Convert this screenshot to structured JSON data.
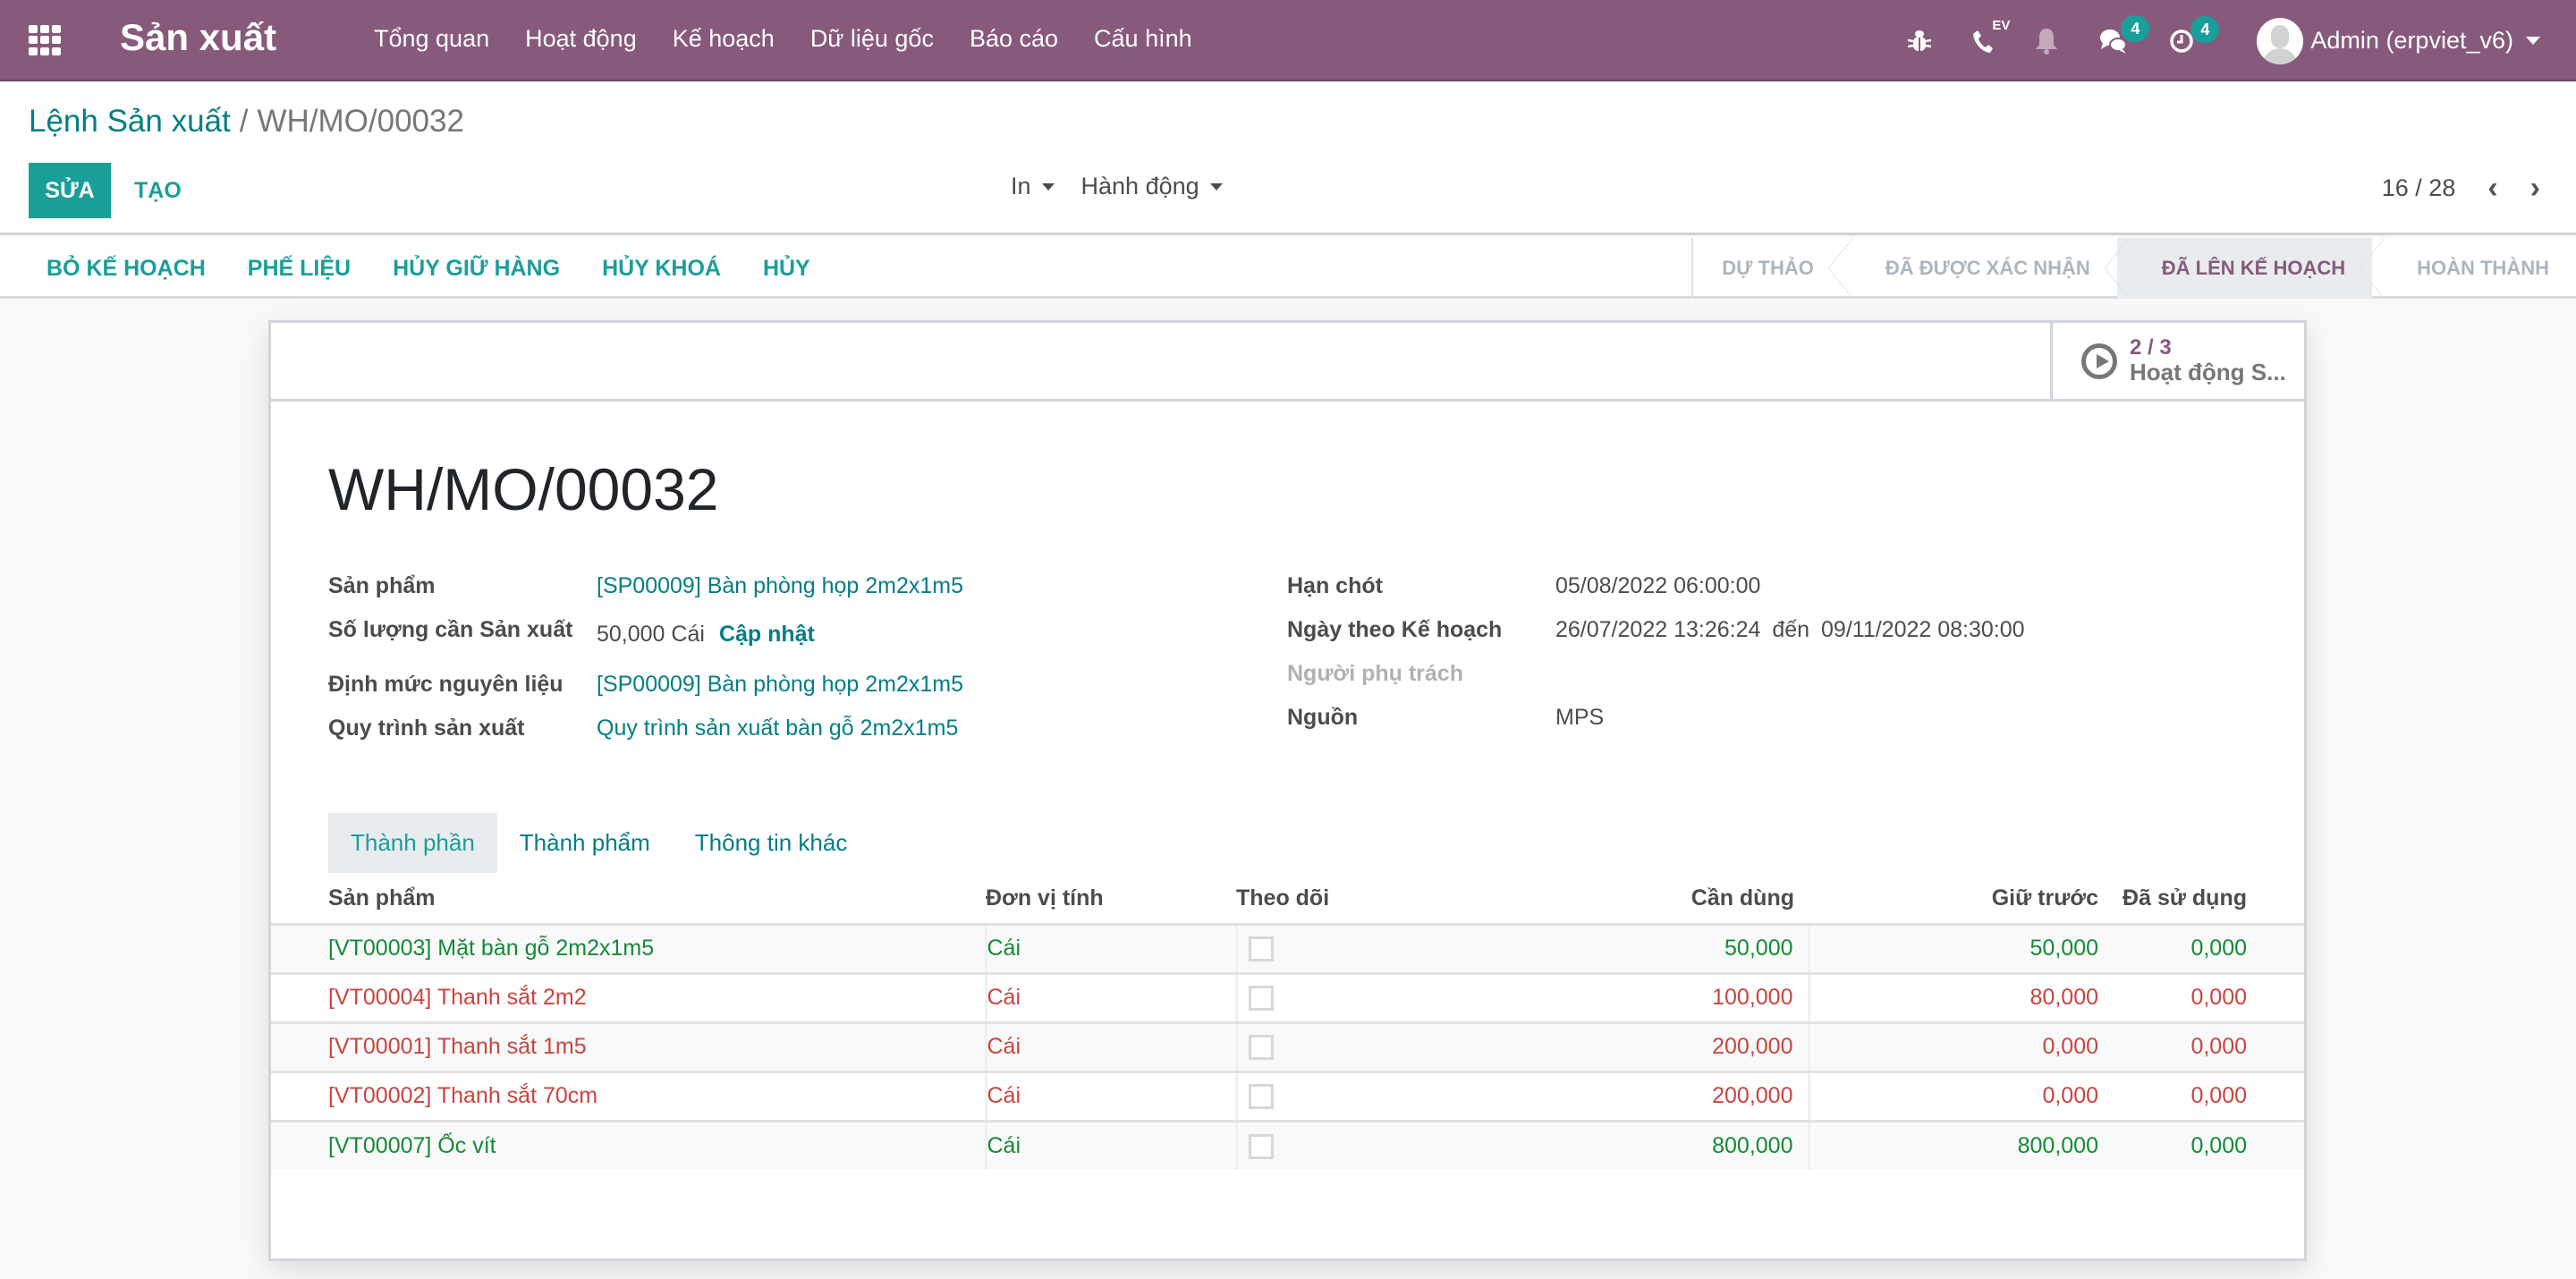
{
  "navbar": {
    "app_name": "Sản xuất",
    "menu": [
      "Tổng quan",
      "Hoạt động",
      "Kế hoạch",
      "Dữ liệu gốc",
      "Báo cáo",
      "Cấu hình"
    ],
    "systray": {
      "phone_label": "EV",
      "messages_count": "4",
      "activities_count": "4",
      "user_name": "Admin (erpviet_v6)"
    },
    "colors": {
      "brand": "#875a7b",
      "accent": "#1a9e99"
    }
  },
  "control_panel": {
    "breadcrumb": {
      "parent": "Lệnh Sản xuất",
      "separator": "/",
      "current": "WH/MO/00032"
    },
    "edit_label": "SỬA",
    "create_label": "TẠO",
    "print_label": "In",
    "action_label": "Hành động",
    "pager": "16 / 28"
  },
  "statusbar": {
    "buttons": [
      "BỎ KẾ HOẠCH",
      "PHẾ LIỆU",
      "HỦY GIỮ HÀNG",
      "HỦY KHOÁ",
      "HỦY"
    ],
    "stages": [
      {
        "label": "DỰ THẢO",
        "active": false
      },
      {
        "label": "ĐÃ ĐƯỢC XÁC NHẬN",
        "active": false
      },
      {
        "label": "ĐÃ LÊN KẾ HOẠCH",
        "active": true
      },
      {
        "label": "HOÀN THÀNH",
        "active": false
      }
    ]
  },
  "sheet": {
    "smart_button": {
      "value": "2 / 3",
      "label": "Hoạt động S..."
    },
    "title": "WH/MO/00032",
    "left_fields": {
      "product_label": "Sản phẩm",
      "product_value": "[SP00009] Bàn phòng họp 2m2x1m5",
      "qty_label": "Số lượng cần Sản xuất",
      "qty_value": "50,000 Cái",
      "qty_update": "Cập nhật",
      "bom_label": "Định mức nguyên liệu",
      "bom_value": "[SP00009] Bàn phòng họp 2m2x1m5",
      "routing_label": "Quy trình sản xuất",
      "routing_value": "Quy trình sản xuất bàn gỗ 2m2x1m5"
    },
    "right_fields": {
      "deadline_label": "Hạn chót",
      "deadline_value": "05/08/2022 06:00:00",
      "planned_label": "Ngày theo Kế hoạch",
      "planned_start": "26/07/2022 13:26:24",
      "planned_to": "đến",
      "planned_end": "09/11/2022 08:30:00",
      "responsible_label": "Người phụ trách",
      "responsible_value": "",
      "source_label": "Nguồn",
      "source_value": "MPS"
    },
    "tabs": [
      {
        "label": "Thành phần",
        "active": true
      },
      {
        "label": "Thành phẩm",
        "active": false
      },
      {
        "label": "Thông tin khác",
        "active": false
      }
    ],
    "table": {
      "headers": [
        "Sản phẩm",
        "Đơn vị tính",
        "Theo dõi",
        "Cần dùng",
        "Giữ trước",
        "Đã sử dụng"
      ],
      "rows": [
        {
          "product": "[VT00003] Mặt bàn gỗ 2m2x1m5",
          "uom": "Cái",
          "tracked": false,
          "to_consume": "50,000",
          "reserved": "50,000",
          "consumed": "0,000",
          "status": "available"
        },
        {
          "product": "[VT00004] Thanh sắt 2m2",
          "uom": "Cái",
          "tracked": false,
          "to_consume": "100,000",
          "reserved": "80,000",
          "consumed": "0,000",
          "status": "shortage"
        },
        {
          "product": "[VT00001] Thanh sắt 1m5",
          "uom": "Cái",
          "tracked": false,
          "to_consume": "200,000",
          "reserved": "0,000",
          "consumed": "0,000",
          "status": "shortage"
        },
        {
          "product": "[VT00002] Thanh sắt 70cm",
          "uom": "Cái",
          "tracked": false,
          "to_consume": "200,000",
          "reserved": "0,000",
          "consumed": "0,000",
          "status": "shortage"
        },
        {
          "product": "[VT00007] Ốc vít",
          "uom": "Cái",
          "tracked": false,
          "to_consume": "800,000",
          "reserved": "800,000",
          "consumed": "0,000",
          "status": "available"
        }
      ],
      "status_colors": {
        "available": "#138a36",
        "shortage": "#c9443e"
      }
    }
  }
}
